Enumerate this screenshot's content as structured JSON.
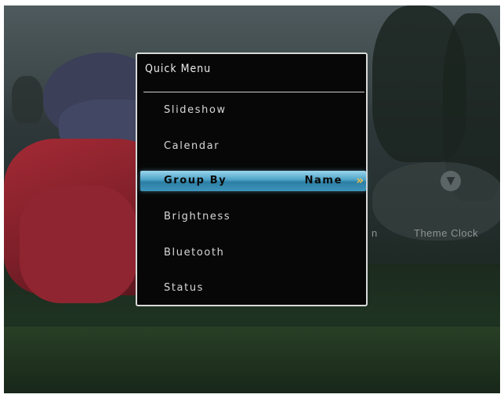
{
  "background": {
    "label_partial": "n",
    "label_theme_clock": "Theme Clock",
    "icon": "clock-icon"
  },
  "quick_menu": {
    "title": "Quick Menu",
    "items": [
      {
        "label": "Slideshow"
      },
      {
        "label": "Calendar"
      },
      {
        "label": "Group By",
        "value": "Name",
        "selected": true
      },
      {
        "label": "Brightness"
      },
      {
        "label": "Bluetooth"
      },
      {
        "label": "Status"
      }
    ],
    "highlight_color": "#4ba2c6",
    "arrow_color": "#f2c24a",
    "arrow_glyph": "»"
  }
}
